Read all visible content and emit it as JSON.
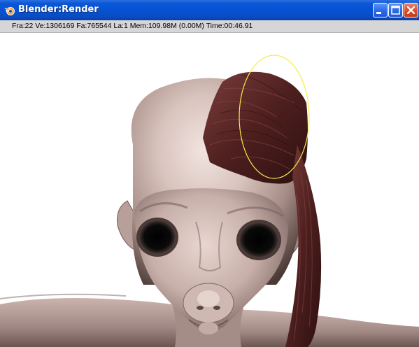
{
  "window": {
    "title": "Blender:Render",
    "buttons": {
      "minimize": "minimize-icon",
      "maximize": "maximize-icon",
      "close": "close-icon"
    },
    "colors": {
      "titlebar": "#0553d2",
      "infobar": "#d6d6d6",
      "close_button": "#d8532f"
    }
  },
  "render_info": {
    "text": "Fra:22  Ve:1306169 Fa:765544 La:1 Mem:109.98M (0.00M) Time:00:46.91"
  },
  "render": {
    "subject": "alien-head-render",
    "annotation": "yellow-ellipse",
    "colors": {
      "skin": "#d9c2bc",
      "skin_shadow": "#6e5a56",
      "hair": "#5a2a2a",
      "annotation": "#f2ee4a"
    }
  }
}
